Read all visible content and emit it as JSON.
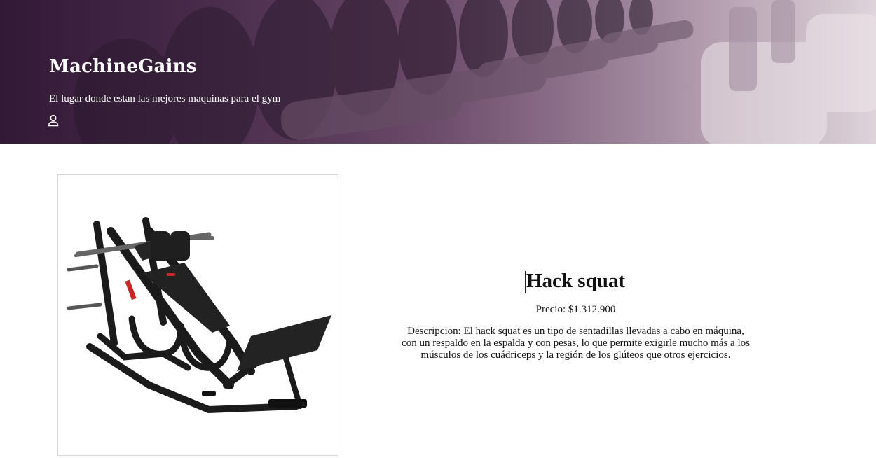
{
  "header": {
    "brand": "MachineGains",
    "tagline": "El lugar donde estan las mejores maquinas para el gym",
    "user_icon": "user-icon",
    "colors": {
      "overlay": "#4a2a4e",
      "text": "#ffffff"
    }
  },
  "product": {
    "image_icon": "hack-squat-machine-image",
    "title": "Hack squat",
    "price": "Precio: $1.312.900",
    "description": "Descripcion: El hack squat es un tipo de sentadillas llevadas a cabo en máquina, con un respaldo en la espalda y con pesas, lo que permite exigirle mucho más a los músculos de los cuádriceps y la región de los glúteos que otros ejercicios."
  }
}
